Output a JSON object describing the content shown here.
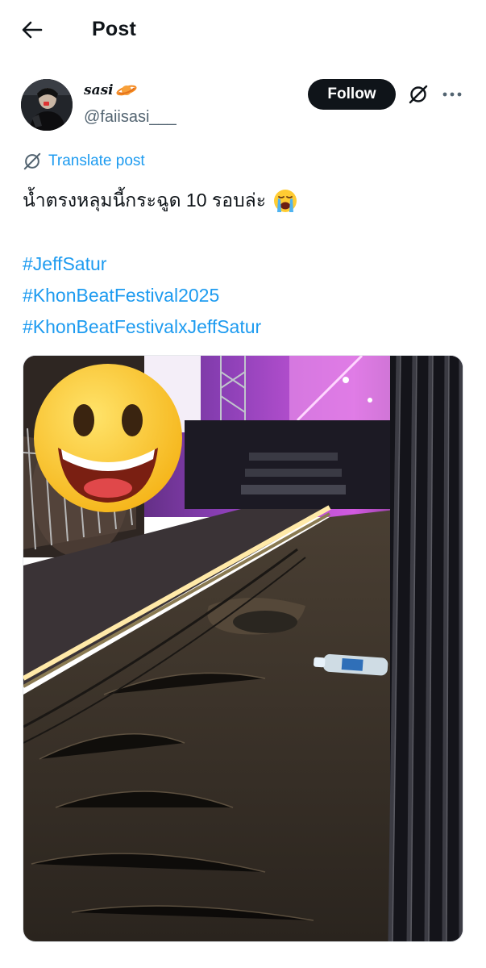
{
  "header": {
    "title": "Post"
  },
  "author": {
    "display_name": "sasi",
    "handle": "@faiisasi___"
  },
  "actions": {
    "follow_label": "Follow"
  },
  "translate": {
    "label": "Translate post"
  },
  "post": {
    "text": "น้ำตรงหลุมนี้กระฉูด 10 รอบล่ะ",
    "emoji": "loudly-crying-face-icon",
    "hashtags": [
      "#JeffSatur",
      "#KhonBeatFestival2025",
      "#KhonBeatFestivalxJeffSatur"
    ]
  },
  "colors": {
    "link": "#1d9bf0",
    "text": "#0f1419",
    "secondary": "#536471",
    "follow_bg": "#0f1419"
  }
}
